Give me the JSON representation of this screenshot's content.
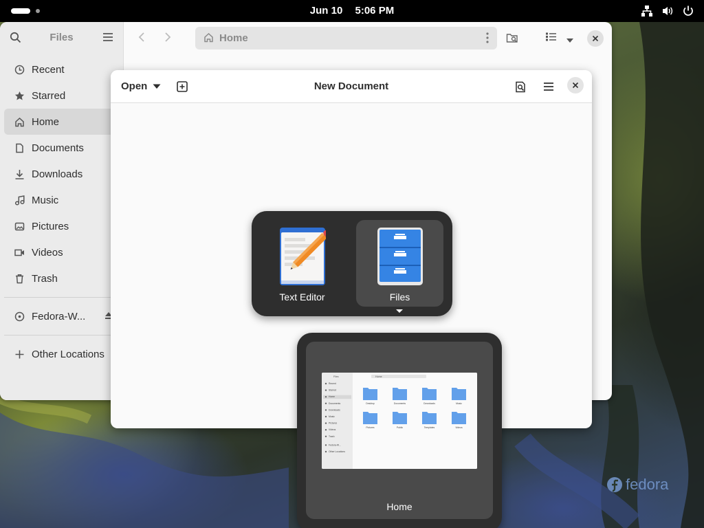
{
  "topbar": {
    "date": "Jun 10",
    "time": "5:06 PM",
    "icons": [
      "network-icon",
      "volume-icon",
      "power-icon"
    ]
  },
  "files": {
    "sidebar": {
      "title": "Files",
      "items": [
        {
          "label": "Recent",
          "icon": "clock-icon"
        },
        {
          "label": "Starred",
          "icon": "star-icon"
        },
        {
          "label": "Home",
          "icon": "home-icon",
          "active": true
        },
        {
          "label": "Documents",
          "icon": "document-icon"
        },
        {
          "label": "Downloads",
          "icon": "download-icon"
        },
        {
          "label": "Music",
          "icon": "music-icon"
        },
        {
          "label": "Pictures",
          "icon": "picture-icon"
        },
        {
          "label": "Videos",
          "icon": "video-icon"
        },
        {
          "label": "Trash",
          "icon": "trash-icon"
        }
      ],
      "device": {
        "label": "Fedora-W...",
        "icon": "disc-icon"
      },
      "other": {
        "label": "Other Locations",
        "icon": "plus-icon"
      }
    },
    "pathbar": {
      "label": "Home"
    }
  },
  "editor": {
    "open_label": "Open",
    "title": "New Document"
  },
  "switcher": {
    "apps": [
      {
        "label": "Text Editor"
      },
      {
        "label": "Files",
        "selected": true
      }
    ]
  },
  "window_preview": {
    "label": "Home",
    "thumbnail": {
      "sidebar_items": [
        "Recent",
        "Starred",
        "Home",
        "Documents",
        "Downloads",
        "Music",
        "Pictures",
        "Videos",
        "Trash",
        "Fedora-W...",
        "Other Locations"
      ],
      "folders": [
        "Desktop",
        "Documents",
        "Downloads",
        "Music",
        "Pictures",
        "Public",
        "Templates",
        "Videos"
      ]
    }
  },
  "wallpaper_logo": "fedora",
  "colors": {
    "accent": "#3584e4",
    "folder": "#62a0ea"
  }
}
